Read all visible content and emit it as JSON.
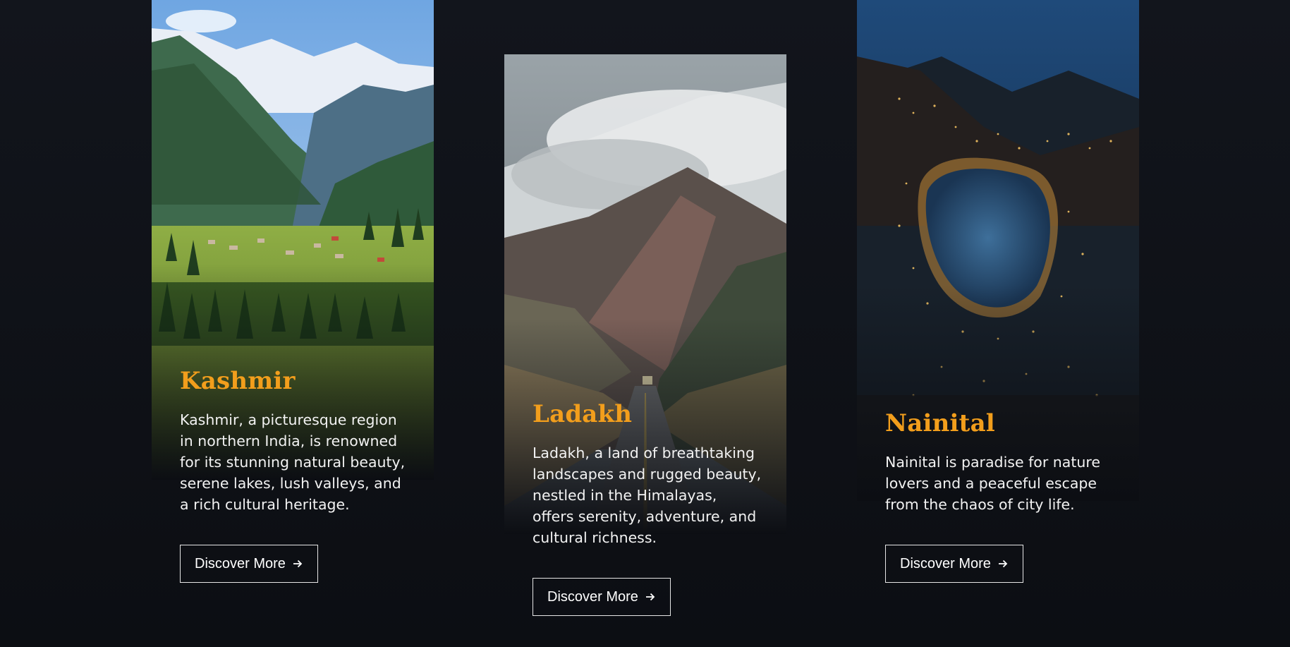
{
  "cards": [
    {
      "id": "kashmir",
      "title": "Kashmir",
      "description": "Kashmir, a picturesque region in northern India, is renowned for its stunning natural beauty, serene lakes, lush valleys, and a rich cultural heritage.",
      "button_label": "Discover More",
      "button_icon": "arrow-right-icon",
      "image_subject": "snowy-mountain-valley-with-meadow-and-pines"
    },
    {
      "id": "ladakh",
      "title": "Ladakh",
      "description": "Ladakh, a land of breathtaking landscapes and rugged beauty, nestled in the Himalayas, offers serenity, adventure, and cultural richness.",
      "button_label": "Discover More",
      "button_icon": "arrow-right-icon",
      "image_subject": "cloud-covered-mountain-road"
    },
    {
      "id": "nainital",
      "title": "Nainital",
      "description": "Nainital is paradise for nature lovers and a peaceful escape from the chaos of city life.",
      "button_label": "Discover More",
      "button_icon": "arrow-right-icon",
      "image_subject": "lake-town-at-night"
    }
  ],
  "colors": {
    "background": "#0f1218",
    "title_accent": "#f29e1c",
    "text": "#f2f2f2",
    "button_border": "#e6e6e6"
  }
}
